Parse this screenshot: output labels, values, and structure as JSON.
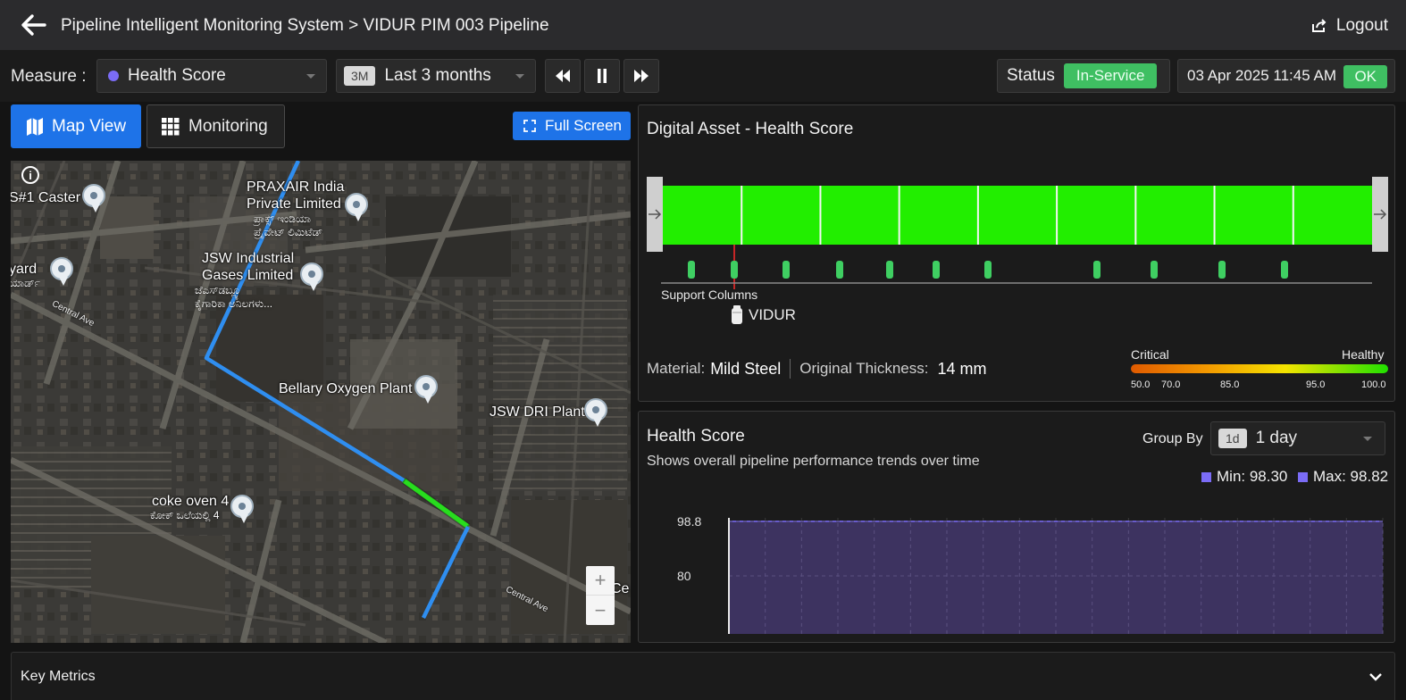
{
  "header": {
    "title": "Pipeline Intelligent Monitoring System > VIDUR PIM 003 Pipeline",
    "logout_label": "Logout"
  },
  "toolbar": {
    "measure_label": "Measure :",
    "measure_value": "Health Score",
    "range_chip": "3M",
    "range_value": "Last 3 months",
    "status_label": "Status",
    "status_value": "In-Service",
    "datetime": "03 Apr 2025 11:45 AM",
    "datetime_status": "OK"
  },
  "views": {
    "map_view_label": "Map View",
    "monitoring_label": "Monitoring",
    "fullscreen_label": "Full Screen"
  },
  "map": {
    "places": [
      {
        "name": "S#1 Caster"
      },
      {
        "name": "PRAXAIR India Private Limited",
        "line1": "PRAXAIR India",
        "line2": "Private Limited",
        "sub": "ಪ್ರಾಕ್ಸ್ ಇಂಡಿಯಾ ಪ್ರೈವೇಟ್ ಲಿಮಿಟೆಡ್"
      },
      {
        "name": "yard",
        "sub": "ಯಾರ್ಡ್"
      },
      {
        "name": "JSW Industrial Gases Limited",
        "line1": "JSW Industrial",
        "line2": "Gases Limited",
        "sub": "ಜೆಎಸ್‌ಡಬ್ಲ್ಯೂ ಕೈಗಾರಿಕಾ ಅನಿಲಗಳು..."
      },
      {
        "name": "Bellary Oxygen Plant"
      },
      {
        "name": "JSW DRI Plant"
      },
      {
        "name": "coke oven 4",
        "sub": "ಕೋಕ್ ಒಲೆಯಲ್ಲಿ 4"
      }
    ],
    "roads": [
      "Central Ave",
      "Central Ave"
    ],
    "edge_label": "Ce",
    "zoom_in": "+",
    "zoom_out": "−"
  },
  "asset": {
    "title": "Digital Asset - Health Score",
    "support_label": "Support Columns",
    "sensor_label": "VIDUR",
    "material_label": "Material:",
    "material_value": "Mild Steel",
    "thickness_label": "Original Thickness:",
    "thickness_value": "14 mm",
    "legend_left": "Critical",
    "legend_right": "Healthy",
    "legend_ticks": [
      "50.0",
      "70.0",
      "85.0",
      "95.0",
      "100.0"
    ],
    "segment_count": 9,
    "support_count": 11,
    "colors": {
      "healthy": "#22ee00",
      "sensor_marker": "#ff2a2a"
    }
  },
  "health": {
    "title": "Health Score",
    "subtitle": "Shows overall pipeline performance trends over time",
    "group_by_label": "Group By",
    "group_chip": "1d",
    "group_value": "1 day",
    "min_label": "Min: 98.30",
    "max_label": "Max: 98.82",
    "chart_data": {
      "type": "area",
      "title": "",
      "ytick_labels": [
        "98.8",
        "80"
      ],
      "yticks": [
        98.8,
        80
      ],
      "ylim": [
        60,
        100
      ],
      "series": [
        {
          "values": [
            98.8,
            98.8,
            98.8,
            98.8,
            98.8,
            98.8,
            98.8,
            98.8,
            98.8,
            98.8,
            98.8,
            98.8,
            98.8,
            98.8,
            98.8,
            98.8,
            98.8,
            98.8,
            98.8
          ]
        }
      ],
      "grid": true,
      "color": "#7b6cf6"
    }
  },
  "footer": {
    "key_metrics_label": "Key Metrics"
  }
}
